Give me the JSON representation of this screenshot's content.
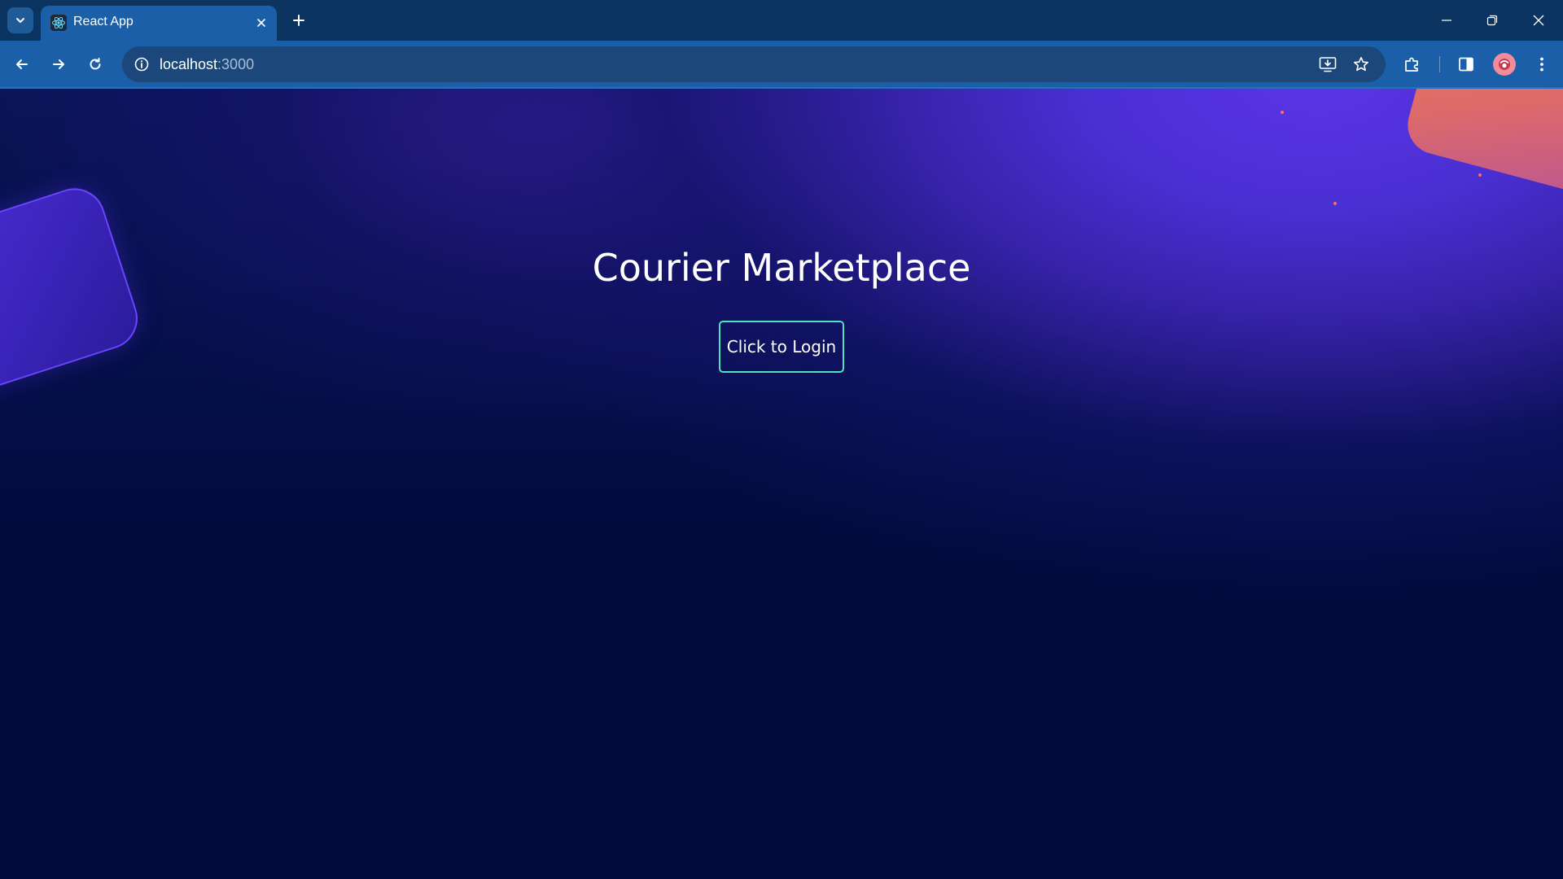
{
  "browser": {
    "tab": {
      "title": "React App",
      "favicon": "react-logo-icon"
    },
    "address": {
      "host": "localhost",
      "port": ":3000"
    },
    "icons": {
      "tab_search": "chevron-down-icon",
      "tab_close": "close-icon",
      "new_tab": "plus-icon",
      "minimize": "minimize-icon",
      "restore": "restore-icon",
      "close_window": "close-icon",
      "back": "arrow-left-icon",
      "forward": "arrow-right-icon",
      "reload": "reload-icon",
      "site_info": "info-icon",
      "install_app": "install-icon",
      "bookmark": "star-icon",
      "extensions": "puzzle-icon",
      "side_panel": "side-panel-icon",
      "profile": "avatar",
      "menu": "more-vert-icon"
    },
    "colors": {
      "tabstrip": "#0b3460",
      "toolbar": "#1a5fa8",
      "omnibox": "#1b477a"
    }
  },
  "page": {
    "title": "Courier Marketplace",
    "login_button": "Click to Login",
    "colors": {
      "background": "#020b3d",
      "accent_purple": "#5a35e6",
      "accent_orange": "#f2784a",
      "button_border": "#4fe3bd"
    }
  }
}
